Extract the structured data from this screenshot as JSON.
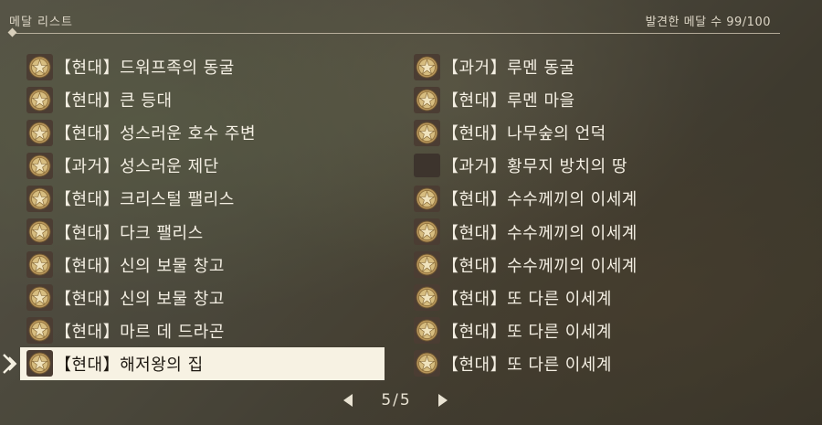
{
  "header": {
    "title": "메달 리스트",
    "found_count": "발견한 메달 수 99/100"
  },
  "left_items": [
    {
      "label": "【현대】드워프족의 동굴",
      "icon": "medal-icon",
      "selected": false
    },
    {
      "label": "【현대】큰 등대",
      "icon": "medal-icon",
      "selected": false
    },
    {
      "label": "【현대】성스러운 호수 주변",
      "icon": "medal-icon",
      "selected": false
    },
    {
      "label": "【과거】성스러운 제단",
      "icon": "medal-icon",
      "selected": false
    },
    {
      "label": "【현대】크리스털 팰리스",
      "icon": "medal-icon",
      "selected": false
    },
    {
      "label": "【현대】다크 팰리스",
      "icon": "medal-icon",
      "selected": false
    },
    {
      "label": "【현대】신의 보물 창고",
      "icon": "medal-icon",
      "selected": false
    },
    {
      "label": "【현대】신의 보물 창고",
      "icon": "medal-icon",
      "selected": false
    },
    {
      "label": "【현대】마르 데 드라곤",
      "icon": "medal-icon",
      "selected": false
    },
    {
      "label": "【현대】해저왕의 집",
      "icon": "medal-icon",
      "selected": true
    }
  ],
  "right_items": [
    {
      "label": "【과거】루멘 동굴",
      "icon": "medal-icon",
      "selected": false
    },
    {
      "label": "【현대】루멘 마을",
      "icon": "medal-icon",
      "selected": false
    },
    {
      "label": "【현대】나무숲의 언덕",
      "icon": "medal-icon",
      "selected": false
    },
    {
      "label": "【과거】황무지 방치의 땅",
      "icon": "empty-medal-slot",
      "selected": false
    },
    {
      "label": "【현대】수수께끼의 이세계",
      "icon": "medal-icon",
      "selected": false
    },
    {
      "label": "【현대】수수께끼의 이세계",
      "icon": "medal-icon",
      "selected": false
    },
    {
      "label": "【현대】수수께끼의 이세계",
      "icon": "medal-icon",
      "selected": false
    },
    {
      "label": "【현대】또 다른 이세계",
      "icon": "medal-icon",
      "selected": false
    },
    {
      "label": "【현대】또 다른 이세계",
      "icon": "medal-icon",
      "selected": false
    },
    {
      "label": "【현대】또 다른 이세계",
      "icon": "medal-icon",
      "selected": false
    }
  ],
  "pager": {
    "page_label": "5/5",
    "current_page": 5,
    "total_pages": 5,
    "prev_icon": "triangle-left-icon",
    "next_icon": "triangle-right-icon"
  },
  "colors": {
    "selected_row_bg": "#f7f2e3",
    "text": "#f4efe3",
    "medal_gold": "#c9a85c"
  }
}
